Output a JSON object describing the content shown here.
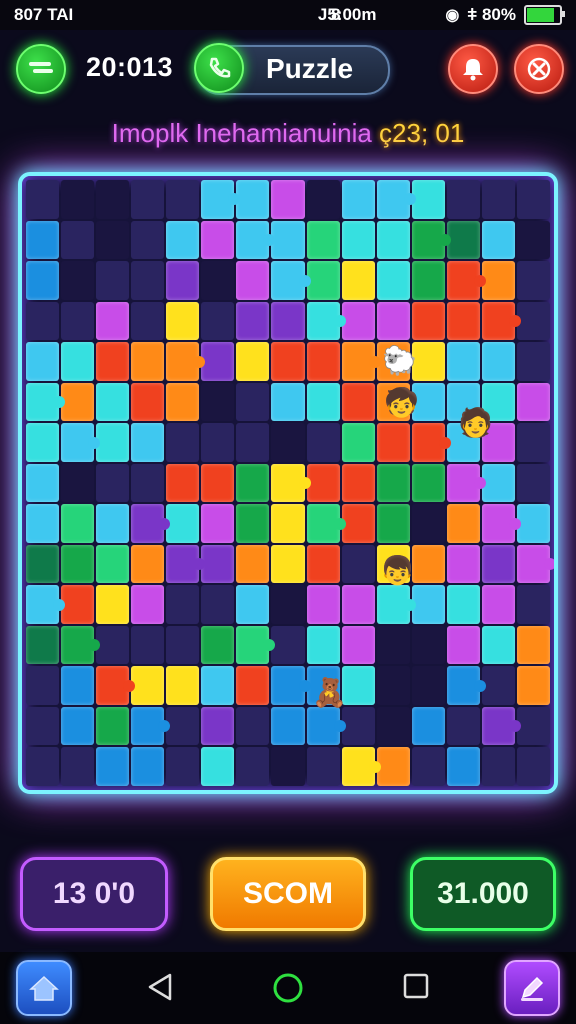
{
  "status_bar": {
    "left_text": "807 TAI",
    "time": "J5:00m",
    "battery": "8",
    "signal_text": "ǂ 80%",
    "battery_level": 0.8
  },
  "top_bar": {
    "timer": "20:013",
    "mode_label": "Puzzle",
    "icons": [
      "menu-icon",
      "phone-icon",
      "alert-icon",
      "close-icon"
    ]
  },
  "headline": {
    "title": "Imoplk Inehamianuinia",
    "score": "ç23; 01"
  },
  "board": {
    "columns": 15,
    "rows": 15,
    "palette": {
      "a": "#3fc8f0",
      "b": "#1b8fe0",
      "c": "#26d47a",
      "d": "#16a84a",
      "e": "#ffe11d",
      "f": "#ff8a17",
      "g": "#f0411f",
      "h": "#c84de8",
      "i": "#7a36c8",
      "j": "#2a2460",
      "k": "#36e0e0",
      "l": "#0f7a4a",
      "m": "#1a1540",
      "n": "#ff5aa0",
      "o": "#5cf25c"
    },
    "rows_data": [
      "jmmjjaahmaakjjj",
      "bjmjahaackkdlam",
      "bmjjimhacekdgfj",
      "jjhjejiikhhgggj",
      "akgffieggffeaaj",
      "kfkgfmjakgfaakh",
      "kakajjjmjcggahj",
      "amjjggdeggddhaj",
      "acaikhdecgdmfha",
      "ldcfiifegjefhih",
      "agehjjamhhkakhj",
      "ldjjjdcjkhmmhkf",
      "jbgeeagbbkmmbjf",
      "jbdbjijbbjmbjij",
      "jjbbjkjmjefjbjj"
    ]
  },
  "buttons": {
    "left": "13 0'0",
    "center": "SCOM",
    "right": "31.000"
  },
  "nav": {
    "icons": [
      "home-icon",
      "back-icon",
      "home-circle-icon",
      "recent-icon",
      "edit-icon"
    ]
  }
}
